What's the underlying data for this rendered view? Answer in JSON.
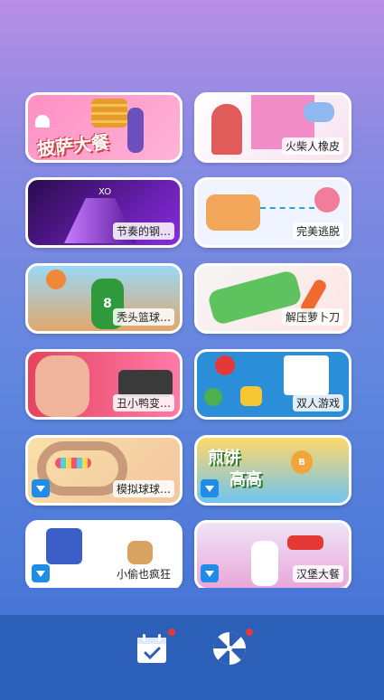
{
  "cards": [
    {
      "id": "pizza",
      "title": "披萨大餐",
      "label": ""
    },
    {
      "id": "matchman",
      "title": "",
      "label": "火柴人橡皮"
    },
    {
      "id": "piano",
      "title": "",
      "label": "节奏的钢…"
    },
    {
      "id": "escape",
      "title": "",
      "label": "完美逃脱"
    },
    {
      "id": "bald",
      "title": "",
      "label": "秃头篮球…"
    },
    {
      "id": "carrot",
      "title": "",
      "label": "解压萝卜刀"
    },
    {
      "id": "duck",
      "title": "",
      "label": "丑小鸭变…"
    },
    {
      "id": "two",
      "title": "",
      "label": "双人游戏"
    },
    {
      "id": "ball",
      "title": "",
      "label": "模拟球球…"
    },
    {
      "id": "pancake",
      "title": "煎饼高高",
      "label": ""
    },
    {
      "id": "thief",
      "title": "",
      "label": "小偷也疯狂"
    },
    {
      "id": "burger",
      "title": "",
      "label": "汉堡大餐"
    }
  ],
  "pancake_title_top": "煎饼",
  "pancake_title_bottom": "高高",
  "pancake_emblem": "B",
  "basket_number": "8",
  "piano_note": "XO",
  "icons": [
    "calendar-check-icon",
    "pinwheel-icon"
  ],
  "colors": {
    "accent": "#2c5fb8",
    "badge": "#e53935",
    "download": "#1f8de8"
  }
}
